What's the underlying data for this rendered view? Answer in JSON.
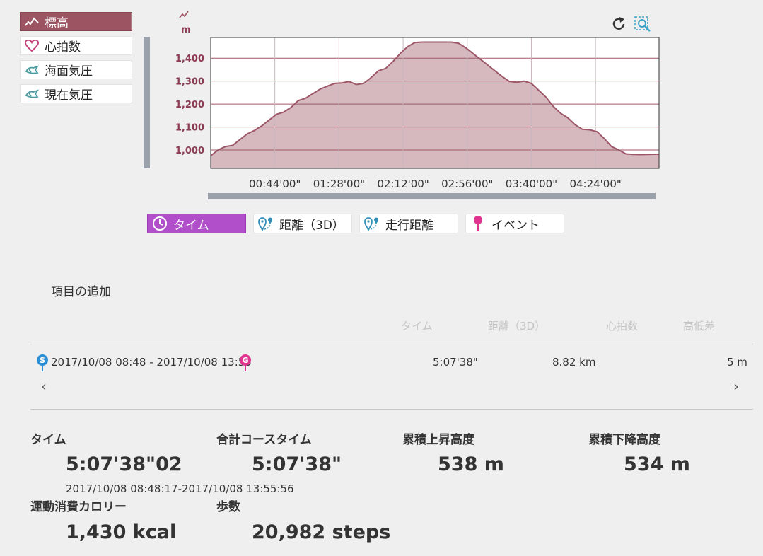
{
  "series_buttons": [
    {
      "label": "標高",
      "icon": "elevation-icon",
      "active": true
    },
    {
      "label": "心拍数",
      "icon": "heart-icon",
      "active": false
    },
    {
      "label": "海面気圧",
      "icon": "sea-pressure-icon",
      "active": false
    },
    {
      "label": "現在気圧",
      "icon": "current-pressure-icon",
      "active": false
    }
  ],
  "chart_data": {
    "type": "area",
    "unit_label": "m",
    "ylim": [
      920,
      1490
    ],
    "yticks": [
      {
        "value": 1000,
        "label": "1,000"
      },
      {
        "value": 1100,
        "label": "1,100"
      },
      {
        "value": 1200,
        "label": "1,200"
      },
      {
        "value": 1300,
        "label": "1,300"
      },
      {
        "value": 1400,
        "label": "1,400"
      }
    ],
    "xlim_minutes": [
      0,
      307.6
    ],
    "xticks": [
      {
        "minutes": 44,
        "label": "00:44'00\""
      },
      {
        "minutes": 88,
        "label": "01:28'00\""
      },
      {
        "minutes": 132,
        "label": "02:12'00\""
      },
      {
        "minutes": 176,
        "label": "02:56'00\""
      },
      {
        "minutes": 220,
        "label": "03:40'00\""
      },
      {
        "minutes": 264,
        "label": "04:24'00\""
      }
    ],
    "x_minutes": [
      0,
      5,
      10,
      15,
      20,
      25,
      30,
      35,
      40,
      45,
      50,
      55,
      60,
      65,
      70,
      75,
      80,
      85,
      90,
      95,
      100,
      105,
      110,
      115,
      120,
      125,
      130,
      135,
      140,
      145,
      150,
      155,
      160,
      165,
      170,
      175,
      180,
      185,
      190,
      195,
      200,
      205,
      210,
      215,
      220,
      225,
      230,
      235,
      240,
      245,
      250,
      255,
      260,
      265,
      270,
      275,
      280,
      285,
      290,
      295,
      300,
      307.6
    ],
    "elevation": [
      975,
      1000,
      1015,
      1020,
      1045,
      1070,
      1085,
      1105,
      1130,
      1155,
      1165,
      1185,
      1215,
      1225,
      1245,
      1265,
      1278,
      1290,
      1292,
      1298,
      1285,
      1290,
      1315,
      1345,
      1355,
      1385,
      1420,
      1450,
      1468,
      1470,
      1470,
      1470,
      1470,
      1470,
      1465,
      1445,
      1420,
      1395,
      1370,
      1345,
      1320,
      1298,
      1295,
      1300,
      1290,
      1260,
      1230,
      1190,
      1160,
      1140,
      1110,
      1090,
      1088,
      1080,
      1050,
      1015,
      1000,
      983,
      981,
      980,
      981,
      982
    ],
    "grid": true,
    "colors": {
      "fill": "#d4b5bc",
      "line": "#9d5768",
      "grid": "#a05866",
      "tick_label": "#8c3d55"
    }
  },
  "axis_tabs": [
    {
      "label": "タイム",
      "icon": "clock-icon",
      "active": true
    },
    {
      "label": "距離（3D）",
      "icon": "distance-3d-icon",
      "active": false
    },
    {
      "label": "走行距離",
      "icon": "route-distance-icon",
      "active": false
    },
    {
      "label": "イベント",
      "icon": "event-pin-icon",
      "active": false
    }
  ],
  "add_items_label": "項目の追加",
  "table": {
    "columns": [
      "タイム",
      "距離（3D）",
      "心拍数",
      "高低差"
    ],
    "row": {
      "range": "2017/10/08 08:48 - 2017/10/08 13:55",
      "start_badge": "S",
      "goal_badge": "G",
      "time": "5:07'38\"",
      "distance": "8.82 km",
      "elevation_diff": "5 m"
    },
    "prev_label": "‹",
    "next_label": "›"
  },
  "stats": {
    "time_label": "タイム",
    "time_value": "5:07'38\"02",
    "time_range": "2017/10/08 08:48:17-2017/10/08 13:55:56",
    "course_time_label": "合計コースタイム",
    "course_time_value": "5:07'38\"",
    "ascent_label": "累積上昇高度",
    "ascent_value": "538 m",
    "descent_label": "累積下降高度",
    "descent_value": "534 m",
    "calorie_label": "運動消費カロリー",
    "calorie_value": "1,430 kcal",
    "steps_label": "歩数",
    "steps_value": "20,982 steps"
  },
  "colors": {
    "accent_elevation": "#9c5462",
    "accent_tab": "#b04fc9",
    "pressure_icon": "#4a9aa0",
    "pin_start": "#2a8fd6",
    "pin_goal": "#e0338d"
  }
}
